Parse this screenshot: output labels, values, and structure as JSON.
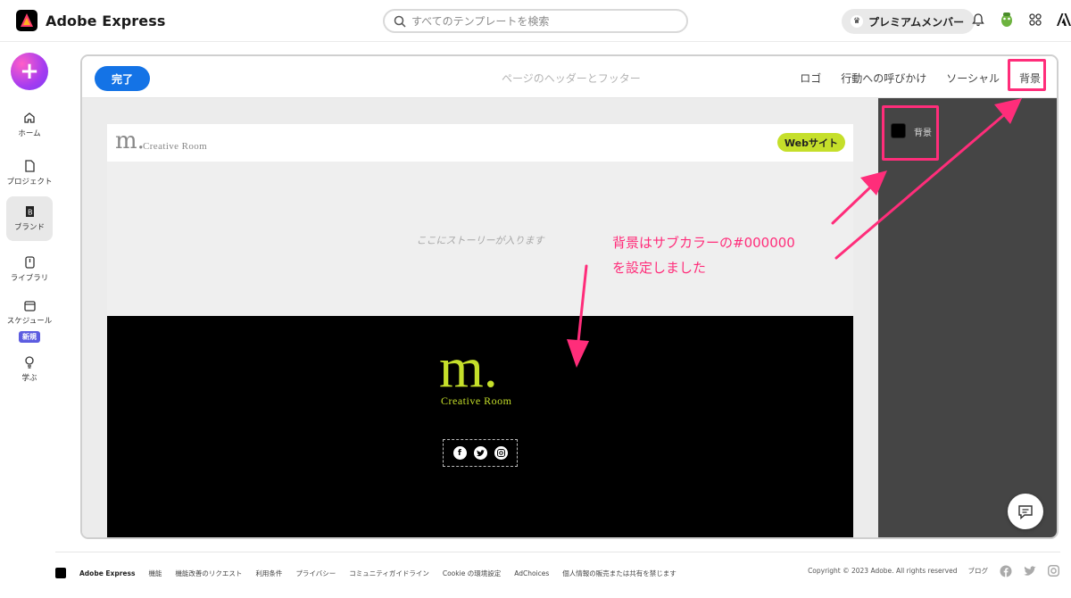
{
  "app": {
    "name": "Adobe Express"
  },
  "search": {
    "placeholder": "すべてのテンプレートを検索"
  },
  "header": {
    "premium_label": "プレミアムメンバー"
  },
  "rail": {
    "items": [
      {
        "label": "ホーム"
      },
      {
        "label": "プロジェクト"
      },
      {
        "label": "ブランド"
      },
      {
        "label": "ライブラリ"
      },
      {
        "label": "スケジュール",
        "badge": "新規"
      },
      {
        "label": "学ぶ"
      }
    ]
  },
  "editor": {
    "done_label": "完了",
    "title": "ページのヘッダーとフッター",
    "tabs": [
      {
        "label": "ロゴ"
      },
      {
        "label": "行動への呼びかけ"
      },
      {
        "label": "ソーシャル"
      },
      {
        "label": "背景"
      }
    ],
    "panel": {
      "swatch_label": "背景",
      "swatch_color": "#000000"
    }
  },
  "page": {
    "logo_mark": "m.",
    "logo_text": "Creative Room",
    "website_button": "Webサイト",
    "story_placeholder": "ここにストーリーが入ります",
    "footer_logo_mark": "m.",
    "footer_logo_text": "Creative Room",
    "social_icons": [
      "facebook-icon",
      "twitter-icon",
      "instagram-icon"
    ]
  },
  "annotation": {
    "line1": "背景はサブカラーの#000000",
    "line2": "を設定しました",
    "color": "#ff2d7a"
  },
  "footer": {
    "brand": "Adobe Express",
    "links": [
      "機能",
      "機能改善のリクエスト",
      "利用条件",
      "プライバシー",
      "コミュニティガイドライン",
      "Cookie の環境設定",
      "AdChoices",
      "個人情報の販売または共有を禁じます"
    ],
    "copyright": "Copyright © 2023 Adobe. All rights reserved",
    "blog": "ブログ"
  },
  "colors": {
    "accent": "#1473e6",
    "brand_lime": "#c5df2a",
    "highlight": "#ff2d7a"
  }
}
